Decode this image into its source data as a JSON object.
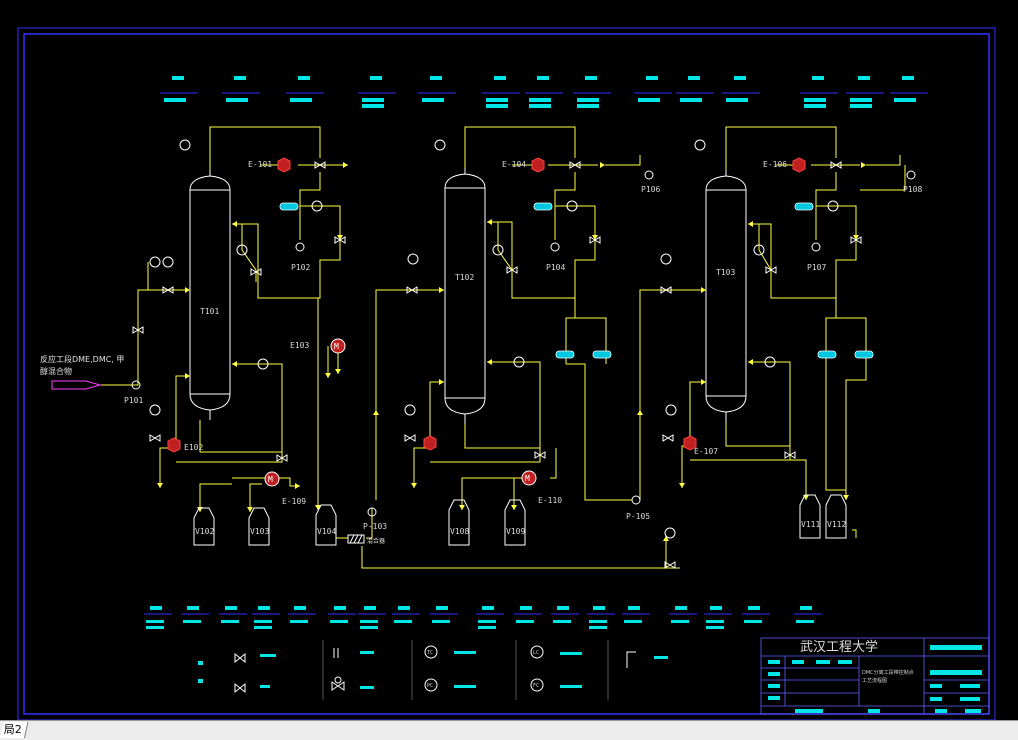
{
  "drawing": {
    "colors": {
      "background": "#000000",
      "frame": "#3030ff",
      "pipe": "#ffff40",
      "text": "#d8d8d8",
      "cyan": "#00e5e5",
      "equipment": "#ffffff",
      "heater": "#ff3030",
      "feed": "#ff40ff"
    },
    "columns": [
      {
        "tag": "T101"
      },
      {
        "tag": "T102"
      },
      {
        "tag": "T103"
      }
    ],
    "condensers": [
      {
        "tag": "E-101"
      },
      {
        "tag": "E-104"
      },
      {
        "tag": "E-106"
      }
    ],
    "reboilers": [
      {
        "tag": "E102"
      },
      {
        "tag": "E-107"
      }
    ],
    "heat_exchangers": [
      {
        "tag": "E103"
      },
      {
        "tag": "E-109"
      },
      {
        "tag": "E-110"
      }
    ],
    "pumps": [
      {
        "tag": "P101"
      },
      {
        "tag": "P102"
      },
      {
        "tag": "P104"
      },
      {
        "tag": "P106"
      },
      {
        "tag": "P107"
      },
      {
        "tag": "P108"
      },
      {
        "tag": "P-103"
      },
      {
        "tag": "P-105"
      }
    ],
    "tanks": [
      {
        "tag": "V102"
      },
      {
        "tag": "V103"
      },
      {
        "tag": "V104"
      },
      {
        "tag": "V108"
      },
      {
        "tag": "V109"
      },
      {
        "tag": "V111"
      },
      {
        "tag": "V112"
      }
    ],
    "mixer_label": "混合器",
    "feed_label_line1": "反应工段DME,DMC, 甲",
    "feed_label_line2": "醇混合物",
    "instrument_labels": {
      "temperature": "TC",
      "pressure": "PC",
      "level": "LC",
      "flow": "FC"
    }
  },
  "title_block": {
    "school": "武汉工程大学",
    "drawing_name_line1": "DMC分离工段带控制点",
    "drawing_name_line2": "工艺流程图"
  },
  "layout_tabs": [
    {
      "label": "局2"
    }
  ]
}
